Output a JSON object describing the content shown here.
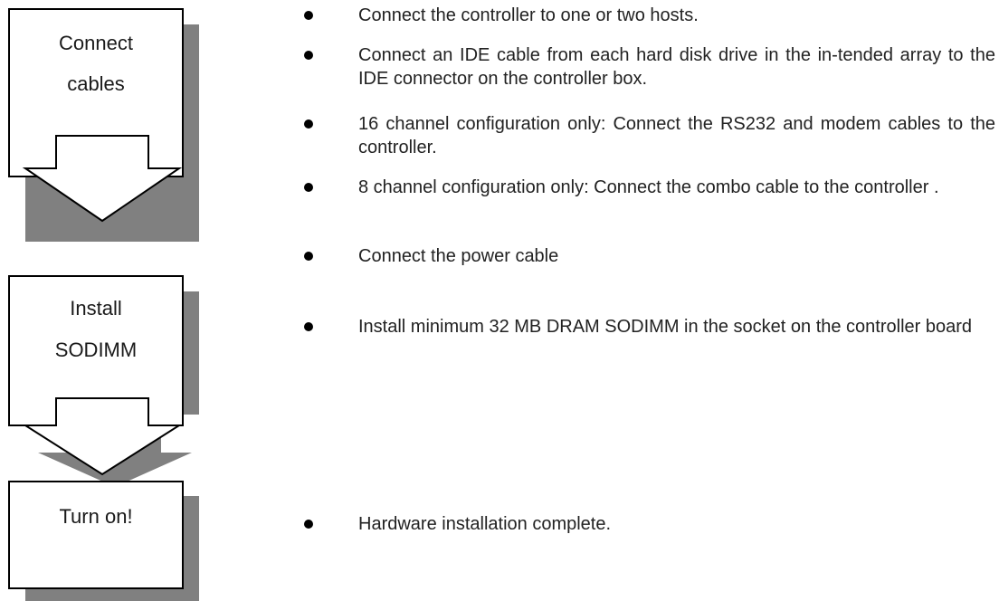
{
  "steps": [
    {
      "label_lines": [
        "Connect",
        "cables"
      ]
    },
    {
      "label_lines": [
        "Install",
        "SODIMM"
      ]
    },
    {
      "label_lines": [
        "Turn on!"
      ]
    }
  ],
  "bullets": [
    "Connect the controller to one or two hosts.",
    "Connect an IDE cable from each hard disk drive in the in-tended array to the IDE connector on the controller box.",
    "16 channel configuration only: Connect the RS232 and modem cables to the controller.",
    "8 channel configuration only: Connect the combo cable to the controller .",
    "Connect the power cable",
    "Install minimum 32 MB DRAM SODIMM in the socket on the controller board",
    "Hardware installation complete."
  ]
}
